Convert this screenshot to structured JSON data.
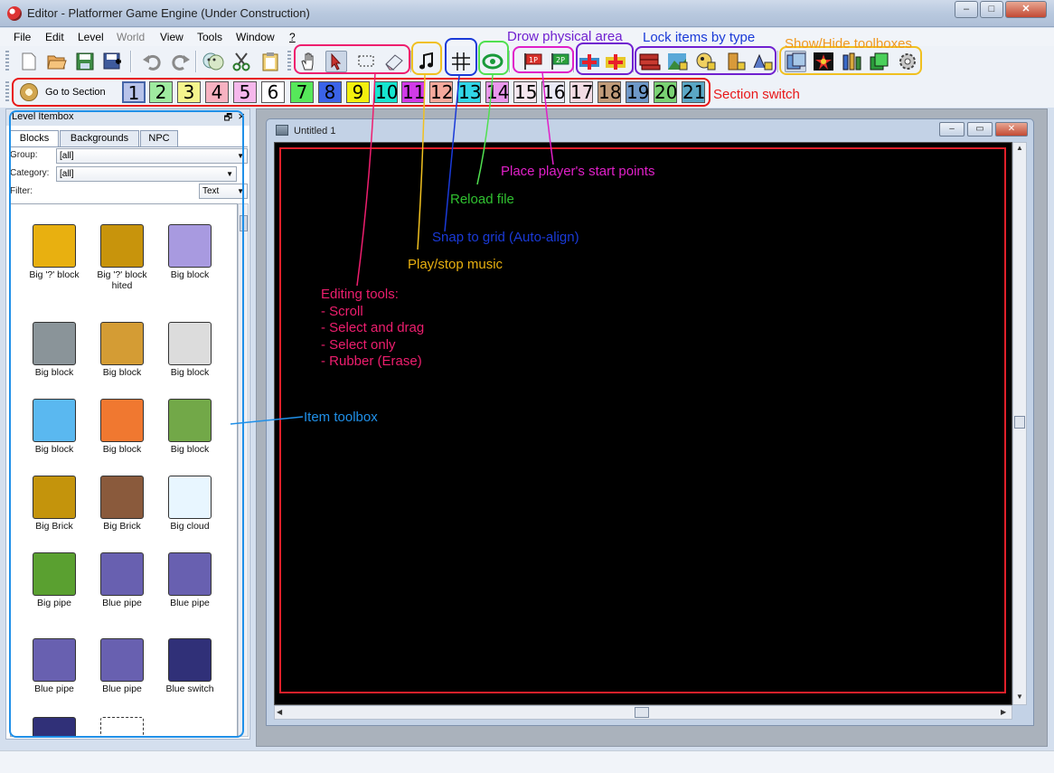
{
  "window": {
    "title": "Editor - Platformer Game Engine (Under Construction)",
    "controls": {
      "minimize": "–",
      "maximize": "□",
      "close": "✕"
    }
  },
  "menu": [
    "File",
    "Edit",
    "Level",
    "World",
    "View",
    "Tools",
    "Window",
    "?"
  ],
  "toolbar": {
    "go_to_section": "Go to Section",
    "sections": [
      "1",
      "2",
      "3",
      "4",
      "5",
      "6",
      "7",
      "8",
      "9",
      "10",
      "11",
      "12",
      "13",
      "14",
      "15",
      "16",
      "17",
      "18",
      "19",
      "20",
      "21"
    ],
    "section_colors": [
      "#b8c3ea",
      "#9feba0",
      "#f5f58d",
      "#f7b2c1",
      "#f5b8ec",
      "#ffffff",
      "#56e85a",
      "#3b63e8",
      "#f3f00f",
      "#16e5cf",
      "#d13be8",
      "#f5a99c",
      "#31d6e8",
      "#ea98ec",
      "#f4e7ef",
      "#eaeaf7",
      "#f2dce4",
      "#c09b79",
      "#6e98c8",
      "#7ad274",
      "#5aa7c5"
    ],
    "icons": [
      "new-file",
      "open-file",
      "save-file",
      "save-as",
      "undo",
      "redo",
      "layers",
      "cut",
      "clipboard",
      "scroll-hand",
      "select-drag",
      "select-only",
      "rubber",
      "music",
      "grid",
      "reload",
      "player-start-1",
      "player-start-2",
      "physical-area-1",
      "physical-area-2",
      "lock-blocks",
      "lock-bgo",
      "lock-npc",
      "lock-doors",
      "lock-warps",
      "toggle-box-1",
      "toggle-box-2",
      "toggle-box-3",
      "toggle-box-4",
      "toggle-box-5"
    ]
  },
  "itembox": {
    "title": "Level Itembox",
    "tabs": [
      "Blocks",
      "Backgrounds",
      "NPC"
    ],
    "group_label": "Group:",
    "group_value": "[all]",
    "category_label": "Category:",
    "category_value": "[all]",
    "filter_label": "Filter:",
    "filter_value": "",
    "filter_mode": "Text",
    "items": [
      {
        "label": "Big '?' block",
        "color": "#e8b010"
      },
      {
        "label": "Big '?' block hited",
        "color": "#c8940c"
      },
      {
        "label": "Big block",
        "color": "#a89ae0"
      },
      {
        "label": "Big block",
        "color": "#8a9499"
      },
      {
        "label": "Big block",
        "color": "#d49c34"
      },
      {
        "label": "Big block",
        "color": "#dcdcdc"
      },
      {
        "label": "Big block",
        "color": "#5ab8f0"
      },
      {
        "label": "Big block",
        "color": "#f07830"
      },
      {
        "label": "Big block",
        "color": "#72a848"
      },
      {
        "label": "Big Brick",
        "color": "#c4940c"
      },
      {
        "label": "Big Brick",
        "color": "#8a5a3c"
      },
      {
        "label": "Big cloud",
        "color": "#e8f6ff"
      },
      {
        "label": "Big pipe",
        "color": "#5aa030"
      },
      {
        "label": "Blue pipe",
        "color": "#6860b0"
      },
      {
        "label": "Blue pipe",
        "color": "#6860b0"
      },
      {
        "label": "Blue pipe",
        "color": "#6860b0"
      },
      {
        "label": "Blue pipe",
        "color": "#6860b0"
      },
      {
        "label": "Blue switch",
        "color": "#303078"
      },
      {
        "label": "",
        "color": "#303078"
      },
      {
        "label": "",
        "color": "#ffffff"
      }
    ]
  },
  "document": {
    "title": "Untitled 1",
    "canvas_color": "#000000",
    "section_border_color": "#e0202a"
  },
  "annotations": {
    "drow_physical_area": "Drow physical area",
    "lock_items": "Lock items by type",
    "show_hide": "Show/Hide toolboxes",
    "section_switch": "Section switch",
    "place_start": "Place player's start points",
    "reload": "Reload file",
    "snap": "Snap to grid (Auto-align)",
    "music": "Play/stop music",
    "editing_tools": [
      "Editing tools:",
      "- Scroll",
      "- Select and drag",
      "- Select only",
      "- Rubber (Erase)"
    ],
    "item_toolbox": "Item toolbox",
    "colors": {
      "pink": "#ee1e6e",
      "yellow": "#f0c020",
      "blue": "#1a3ad8",
      "green": "#50e050",
      "magenta": "#e020c8",
      "purple": "#7020d0",
      "orange": "#f09820",
      "red": "#e81818",
      "light_blue": "#2090e8",
      "dark_pink": "#d81e6e"
    }
  }
}
